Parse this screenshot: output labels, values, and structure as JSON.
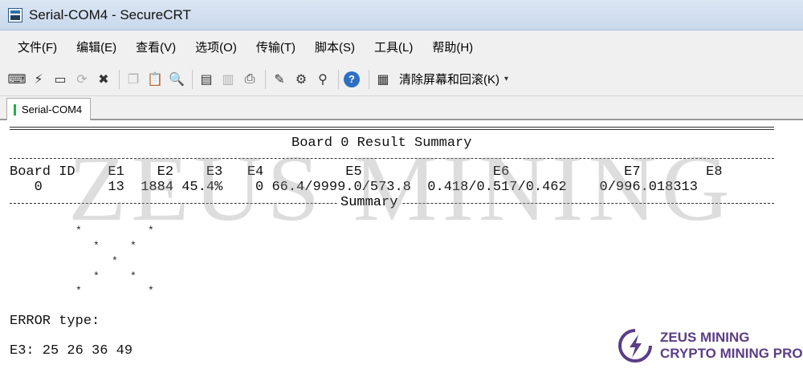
{
  "window": {
    "title": "Serial-COM4 - SecureCRT"
  },
  "menu": {
    "items": [
      "文件(F)",
      "编辑(E)",
      "查看(V)",
      "选项(O)",
      "传输(T)",
      "脚本(S)",
      "工具(L)",
      "帮助(H)"
    ]
  },
  "toolbar": {
    "clear_label": "清除屏幕和回滚(K)",
    "icons": [
      "connect-icon",
      "quick-connect-icon",
      "connect-tab-icon",
      "reconnect-icon",
      "disconnect-icon",
      "copy-icon",
      "paste-icon",
      "find-icon",
      "print-screen-icon",
      "print-selection-icon",
      "print-icon",
      "session-options-icon",
      "global-options-icon",
      "keymap-icon",
      "help-icon",
      "clear-screen-icon"
    ]
  },
  "tab": {
    "label": "Serial-COM4"
  },
  "terminal": {
    "board_title": "Board 0 Result Summary",
    "header_row": "Board ID    E1    E2    E3   E4          E5                E6              E7        E8",
    "data_row": "   0        13  1884 45.4%    0 66.4/9999.0/573.8  0.418/0.517/0.462    0/996.018313",
    "summary_label": "Summary",
    "error_type": "ERROR type:",
    "error_codes": "E3: 25 26 36 49"
  },
  "watermark": "ZEUS MINING",
  "brand": {
    "line1": "ZEUS MINING",
    "line2": "CRYPTO MINING PRO",
    "color": "#5b3d86"
  }
}
